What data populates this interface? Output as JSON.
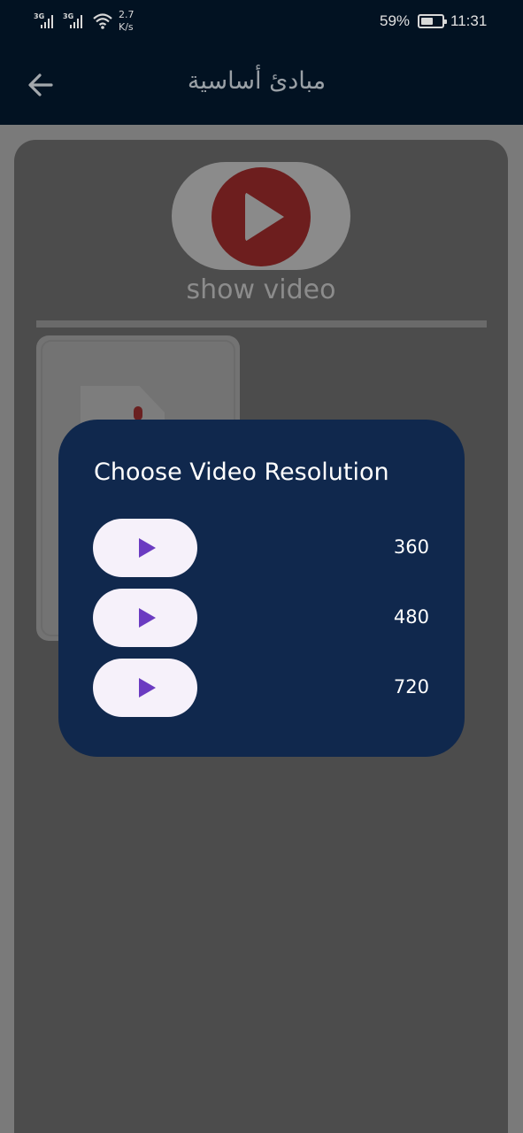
{
  "status_bar": {
    "sim1_type": "3G",
    "sim2_type": "3G",
    "net_speed_value": "2.7",
    "net_speed_unit": "K/s",
    "battery_percent": "59%",
    "time": "11:31"
  },
  "app_bar": {
    "title": "مبادئ أساسية",
    "back_icon": "arrow-left-icon"
  },
  "content": {
    "show_video_label": "show video",
    "play_icon": "play-circle-icon",
    "document_icon": "document-thumbnail-icon"
  },
  "dialog": {
    "title": "Choose Video Resolution",
    "options": [
      {
        "label": "360",
        "icon": "play-icon"
      },
      {
        "label": "480",
        "icon": "play-icon"
      },
      {
        "label": "720",
        "icon": "play-icon"
      }
    ]
  },
  "colors": {
    "app_bar_bg": "#021222",
    "dialog_bg": "#10284d",
    "button_bg": "#f6f1fa",
    "play_accent": "#6b3bc1",
    "video_button_red": "#6d1e1e"
  }
}
